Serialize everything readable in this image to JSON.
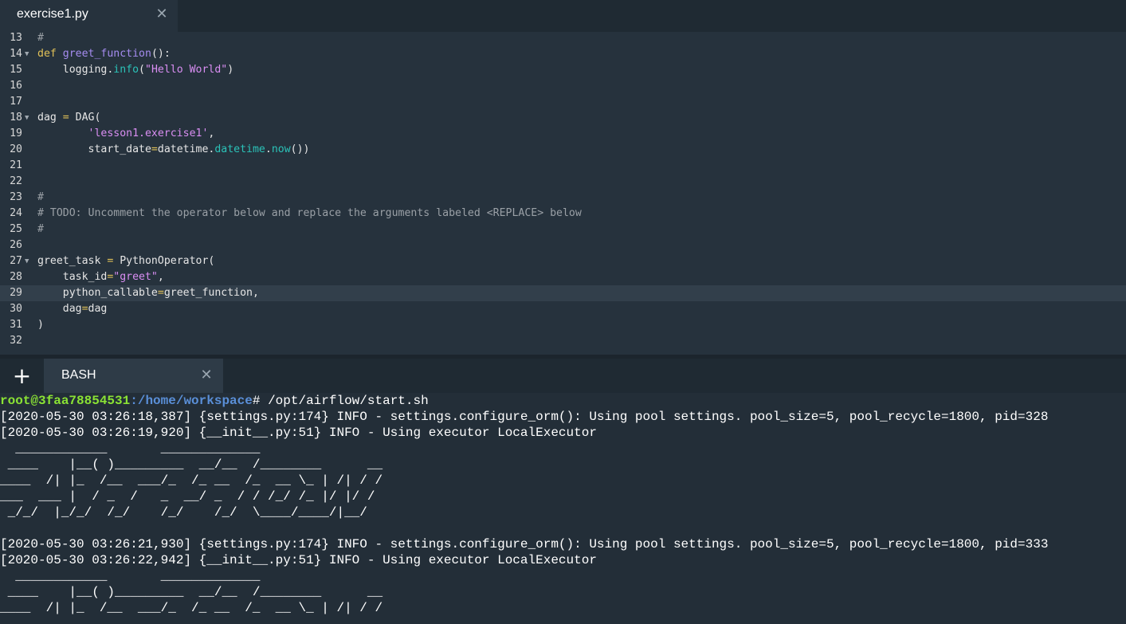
{
  "editor_tab": {
    "title": "exercise1.py",
    "close": "✕"
  },
  "code": [
    {
      "n": "13",
      "fold": false,
      "tokens": [
        {
          "t": "#",
          "c": "cmt"
        }
      ]
    },
    {
      "n": "14",
      "fold": true,
      "tokens": [
        {
          "t": "def",
          "c": "kw"
        },
        {
          "t": " "
        },
        {
          "t": "greet_function",
          "c": "fn"
        },
        {
          "t": "():"
        }
      ]
    },
    {
      "n": "15",
      "fold": false,
      "tokens": [
        {
          "t": "    logging."
        },
        {
          "t": "info",
          "c": "attr"
        },
        {
          "t": "("
        },
        {
          "t": "\"Hello World\"",
          "c": "str"
        },
        {
          "t": ")"
        }
      ]
    },
    {
      "n": "16",
      "fold": false,
      "tokens": []
    },
    {
      "n": "17",
      "fold": false,
      "tokens": []
    },
    {
      "n": "18",
      "fold": true,
      "tokens": [
        {
          "t": "dag "
        },
        {
          "t": "=",
          "c": "op"
        },
        {
          "t": " DAG("
        }
      ]
    },
    {
      "n": "19",
      "fold": false,
      "tokens": [
        {
          "t": "        "
        },
        {
          "t": "'lesson1.exercise1'",
          "c": "str"
        },
        {
          "t": ","
        }
      ]
    },
    {
      "n": "20",
      "fold": false,
      "tokens": [
        {
          "t": "        start_date"
        },
        {
          "t": "=",
          "c": "op"
        },
        {
          "t": "datetime."
        },
        {
          "t": "datetime",
          "c": "attr"
        },
        {
          "t": "."
        },
        {
          "t": "now",
          "c": "attr"
        },
        {
          "t": "())"
        }
      ]
    },
    {
      "n": "21",
      "fold": false,
      "tokens": []
    },
    {
      "n": "22",
      "fold": false,
      "tokens": []
    },
    {
      "n": "23",
      "fold": false,
      "tokens": [
        {
          "t": "#",
          "c": "cmt"
        }
      ]
    },
    {
      "n": "24",
      "fold": false,
      "tokens": [
        {
          "t": "# TODO: Uncomment the operator below and replace the arguments labeled <REPLACE> below",
          "c": "cmt"
        }
      ]
    },
    {
      "n": "25",
      "fold": false,
      "tokens": [
        {
          "t": "#",
          "c": "cmt"
        }
      ]
    },
    {
      "n": "26",
      "fold": false,
      "tokens": []
    },
    {
      "n": "27",
      "fold": true,
      "tokens": [
        {
          "t": "greet_task "
        },
        {
          "t": "=",
          "c": "op"
        },
        {
          "t": " PythonOperator("
        }
      ]
    },
    {
      "n": "28",
      "fold": false,
      "tokens": [
        {
          "t": "    task_id"
        },
        {
          "t": "=",
          "c": "op"
        },
        {
          "t": "\"greet\"",
          "c": "str"
        },
        {
          "t": ","
        }
      ]
    },
    {
      "n": "29",
      "fold": false,
      "active": true,
      "tokens": [
        {
          "t": "    python_callable"
        },
        {
          "t": "=",
          "c": "op"
        },
        {
          "t": "greet_function,"
        }
      ]
    },
    {
      "n": "30",
      "fold": false,
      "tokens": [
        {
          "t": "    dag"
        },
        {
          "t": "=",
          "c": "op"
        },
        {
          "t": "dag"
        }
      ]
    },
    {
      "n": "31",
      "fold": false,
      "tokens": [
        {
          "t": ")"
        }
      ]
    },
    {
      "n": "32",
      "fold": false,
      "tokens": []
    }
  ],
  "terminal_tab": {
    "new_label": "+",
    "title": "BASH",
    "close": "✕"
  },
  "terminal": {
    "prompt_user": "root@3faa78854531",
    "prompt_path": ":/home/workspace",
    "prompt_suffix": "# /opt/airflow/start.sh",
    "lines": [
      "[2020-05-30 03:26:18,387] {settings.py:174} INFO - settings.configure_orm(): Using pool settings. pool_size=5, pool_recycle=1800, pid=328",
      "[2020-05-30 03:26:19,920] {__init__.py:51} INFO - Using executor LocalExecutor",
      "  ____________       _____________",
      " ____    |__( )_________  __/__  /________      __",
      "____  /| |_  /__  ___/_  /_ __  /_  __ \\_ | /| / /",
      "___  ___ |  / _  /   _  __/ _  / / /_/ /_ |/ |/ /",
      " _/_/  |_/_/  /_/    /_/    /_/  \\____/____/|__/",
      "",
      "[2020-05-30 03:26:21,930] {settings.py:174} INFO - settings.configure_orm(): Using pool settings. pool_size=5, pool_recycle=1800, pid=333",
      "[2020-05-30 03:26:22,942] {__init__.py:51} INFO - Using executor LocalExecutor",
      "  ____________       _____________",
      " ____    |__( )_________  __/__  /________      __",
      "____  /| |_  /__  ___/_  /_ __  /_  __ \\_ | /| / /"
    ]
  }
}
